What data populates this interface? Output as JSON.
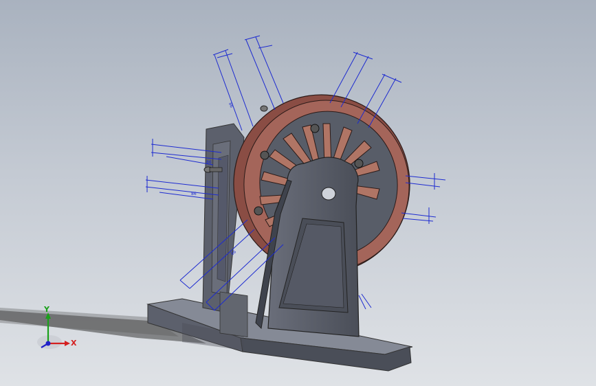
{
  "triad": {
    "x_label": "X",
    "y_label": "Y",
    "x_color": "#d42020",
    "y_color": "#1aa01a",
    "z_color": "#2020c8"
  },
  "colors": {
    "dimension": "#1c2ad0",
    "wheel": "#9a5a50",
    "body": "#5a5e6a",
    "base": "#6b6f7a"
  },
  "dimensions": {
    "d1": "86",
    "d2": "86",
    "d3": "86",
    "d4": "86"
  }
}
